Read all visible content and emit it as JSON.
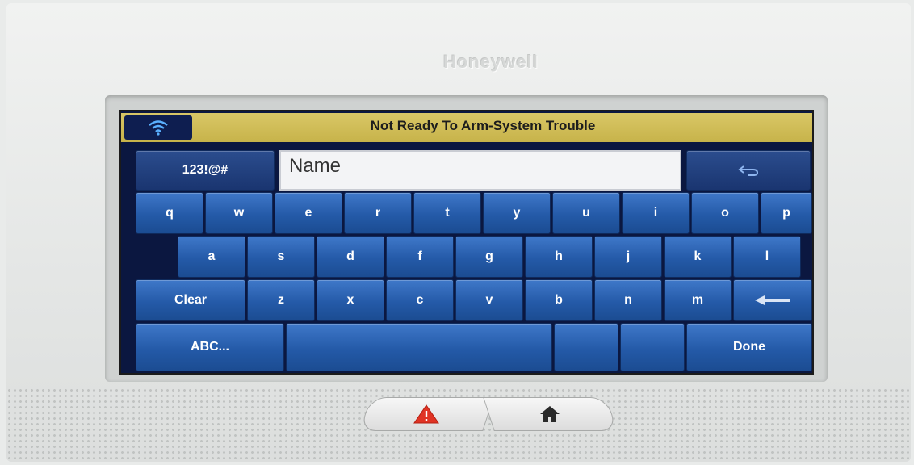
{
  "device": {
    "brand": "Honeywell"
  },
  "status_bar": {
    "message": "Not Ready To Arm-System Trouble",
    "wifi_icon": "wifi-icon"
  },
  "input": {
    "value": "Name"
  },
  "keyboard": {
    "symbols_key": "123!@#",
    "back_key_icon": "return-arrow-icon",
    "row1": [
      "q",
      "w",
      "e",
      "r",
      "t",
      "y",
      "u",
      "i",
      "o",
      "p"
    ],
    "row2": [
      "a",
      "s",
      "d",
      "f",
      "g",
      "h",
      "j",
      "k",
      "l"
    ],
    "clear_key": "Clear",
    "row3": [
      "z",
      "x",
      "c",
      "v",
      "b",
      "n",
      "m"
    ],
    "backspace_icon": "backspace-arrow-icon",
    "abc_key": "ABC...",
    "done_key": "Done"
  },
  "hardware_buttons": {
    "emergency_icon": "warning-triangle-icon",
    "home_icon": "home-icon"
  },
  "colors": {
    "status_bar": "#c9b54b",
    "key_blue": "#2d63b4",
    "screen_bg": "#0b1740"
  }
}
